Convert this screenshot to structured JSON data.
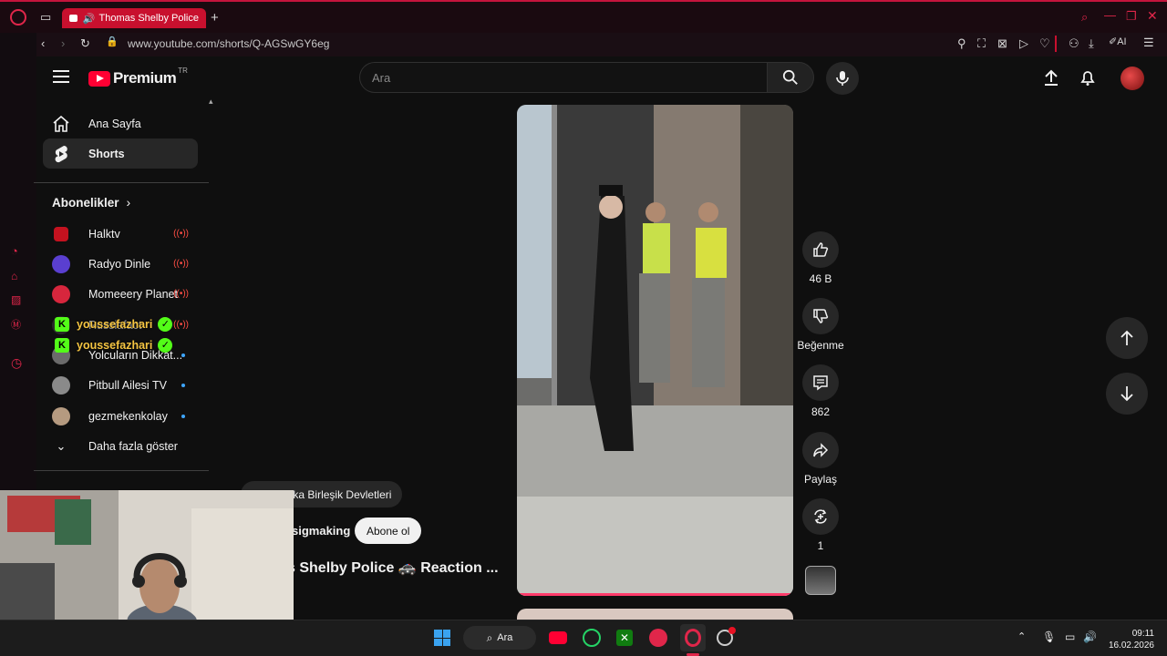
{
  "browser": {
    "tab_title": "Thomas Shelby Police",
    "url": "www.youtube.com/shorts/Q-AGSwGY6eg",
    "ai_label": "AI"
  },
  "header": {
    "logo_text": "Premium",
    "logo_region": "TR",
    "search_placeholder": "Ara"
  },
  "guide": {
    "main": [
      {
        "label": "Ana Sayfa",
        "icon": "home-icon"
      },
      {
        "label": "Shorts",
        "icon": "shorts-icon"
      }
    ],
    "subs_heading": "Abonelikler",
    "subscriptions": [
      {
        "label": "Halktv",
        "indicator": "live"
      },
      {
        "label": "Radyo Dinle",
        "indicator": "live"
      },
      {
        "label": "Momeeery Planet",
        "indicator": "live"
      },
      {
        "label": "Russiafact",
        "indicator": "live"
      },
      {
        "label": "Yolcuların Dikkat...",
        "indicator": "new"
      },
      {
        "label": "Pitbull Ailesi TV",
        "indicator": "new"
      },
      {
        "label": "gezmekenkolay",
        "indicator": "new"
      }
    ],
    "show_more": "Daha fazla göster"
  },
  "overlay": {
    "kick_user": "youssefazhari"
  },
  "short": {
    "location": "Amerika Birleşik Devletleri",
    "channel": "sigmaking",
    "subscribe": "Abone ol",
    "title": "s Shelby Police 🚓 Reaction ...",
    "actions": {
      "like_count": "46 B",
      "dislike_label": "Beğenme",
      "comment_count": "862",
      "share_label": "Paylaş",
      "remix_count": "1"
    }
  },
  "taskbar": {
    "search_label": "Ara",
    "time": "09:11",
    "date": "16.02.2026"
  },
  "colors": {
    "brand_red": "#ff0033",
    "opera_red": "#c8102e",
    "kick_green": "#53fc18",
    "background": "#0f0f0f"
  }
}
